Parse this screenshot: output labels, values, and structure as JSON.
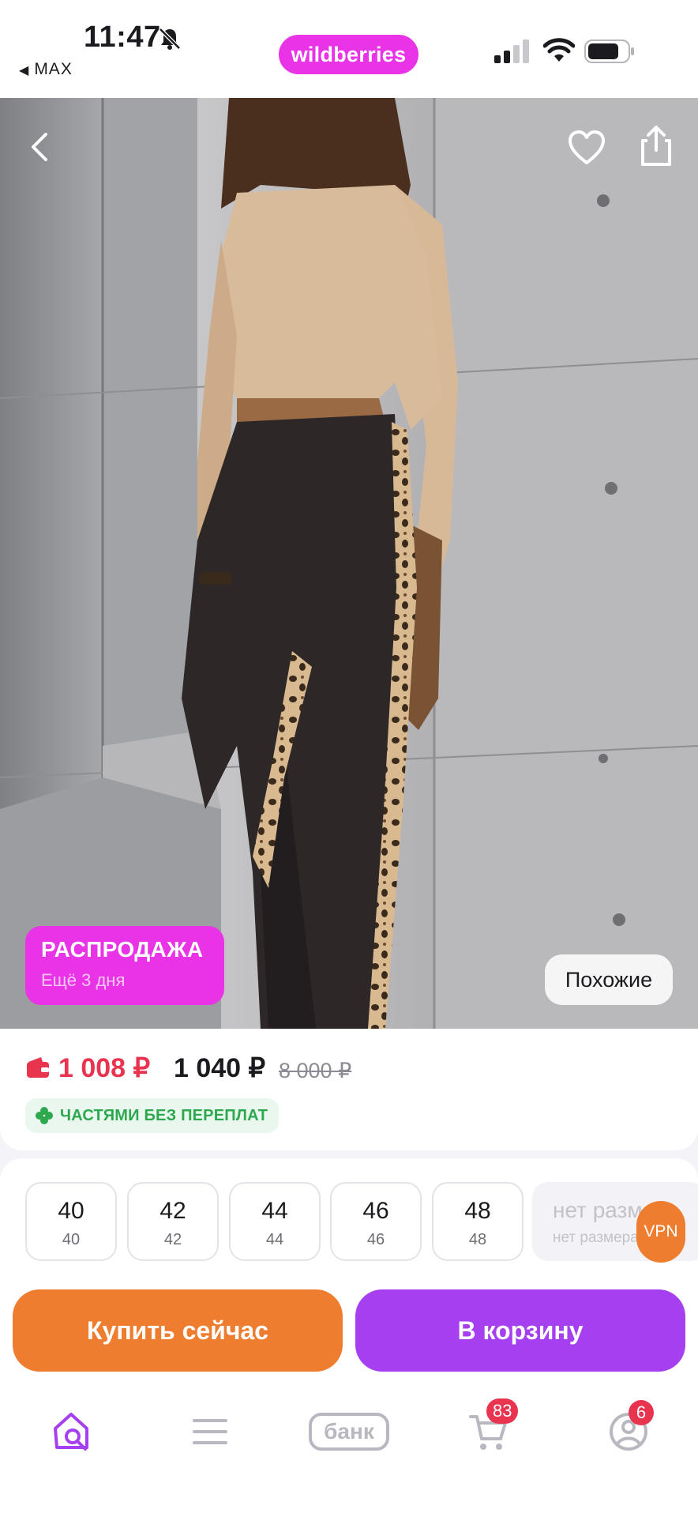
{
  "status_bar": {
    "time": "11:47",
    "back_app": "MAX",
    "brand": "wildberries"
  },
  "product": {
    "sale_badge": {
      "title": "РАСПРОДАЖА",
      "subtitle": "Ещё 3 дня"
    },
    "similar_label": "Похожие",
    "price_wallet": "1 008 ₽",
    "price_main": "1 040 ₽",
    "price_old": "8 000 ₽",
    "installments": "ЧАСТЯМИ БЕЗ ПЕРЕПЛАТ"
  },
  "sizes": [
    {
      "label": "40",
      "ru": "40"
    },
    {
      "label": "42",
      "ru": "42"
    },
    {
      "label": "44",
      "ru": "44"
    },
    {
      "label": "46",
      "ru": "46"
    },
    {
      "label": "48",
      "ru": "48"
    }
  ],
  "size_unavailable": {
    "label": "нет размера",
    "sub": "нет размера"
  },
  "vpn_label": "VPN",
  "actions": {
    "buy_now": "Купить сейчас",
    "add_to_cart": "В корзину"
  },
  "tabbar": {
    "bank_label": "банк",
    "cart_count": "83",
    "profile_count": "6"
  },
  "colors": {
    "brand": "#e834e6",
    "buy_now": "#ef7d2f",
    "add_to_cart": "#a63ff0",
    "price_wallet": "#e8344f",
    "installments": "#2da84f"
  }
}
